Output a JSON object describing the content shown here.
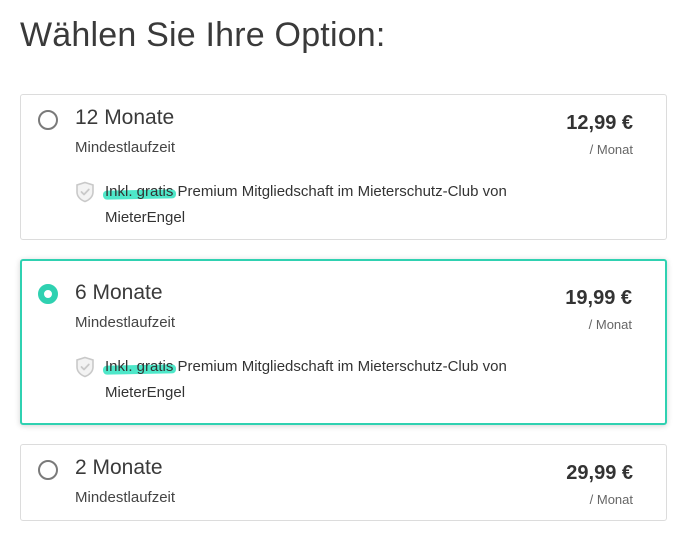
{
  "page": {
    "title": "Wählen Sie Ihre Option:"
  },
  "colors": {
    "accent": "#2fd1b1",
    "highlight": "#2fe3c0",
    "border": "#dcdcdc",
    "text": "#333333"
  },
  "options": [
    {
      "term": "12 Monate",
      "subterm": "Mindestlaufzeit",
      "price": "12,99 €",
      "per_month": "/ Monat",
      "benefit_highlight": "Inkl. gratis",
      "benefit_rest": " Premium Mitgliedschaft im Mieterschutz-Club von MieterEngel",
      "benefit_icon": "shield-icon",
      "selected": false
    },
    {
      "term": "6 Monate",
      "subterm": "Mindestlaufzeit",
      "price": "19,99 €",
      "per_month": "/ Monat",
      "benefit_highlight": "Inkl. gratis",
      "benefit_rest": " Premium Mitgliedschaft im Mieterschutz-Club von MieterEngel",
      "benefit_icon": "shield-icon",
      "selected": true
    },
    {
      "term": "2 Monate",
      "subterm": "Mindestlaufzeit",
      "price": "29,99 €",
      "per_month": "/ Monat",
      "selected": false
    }
  ]
}
